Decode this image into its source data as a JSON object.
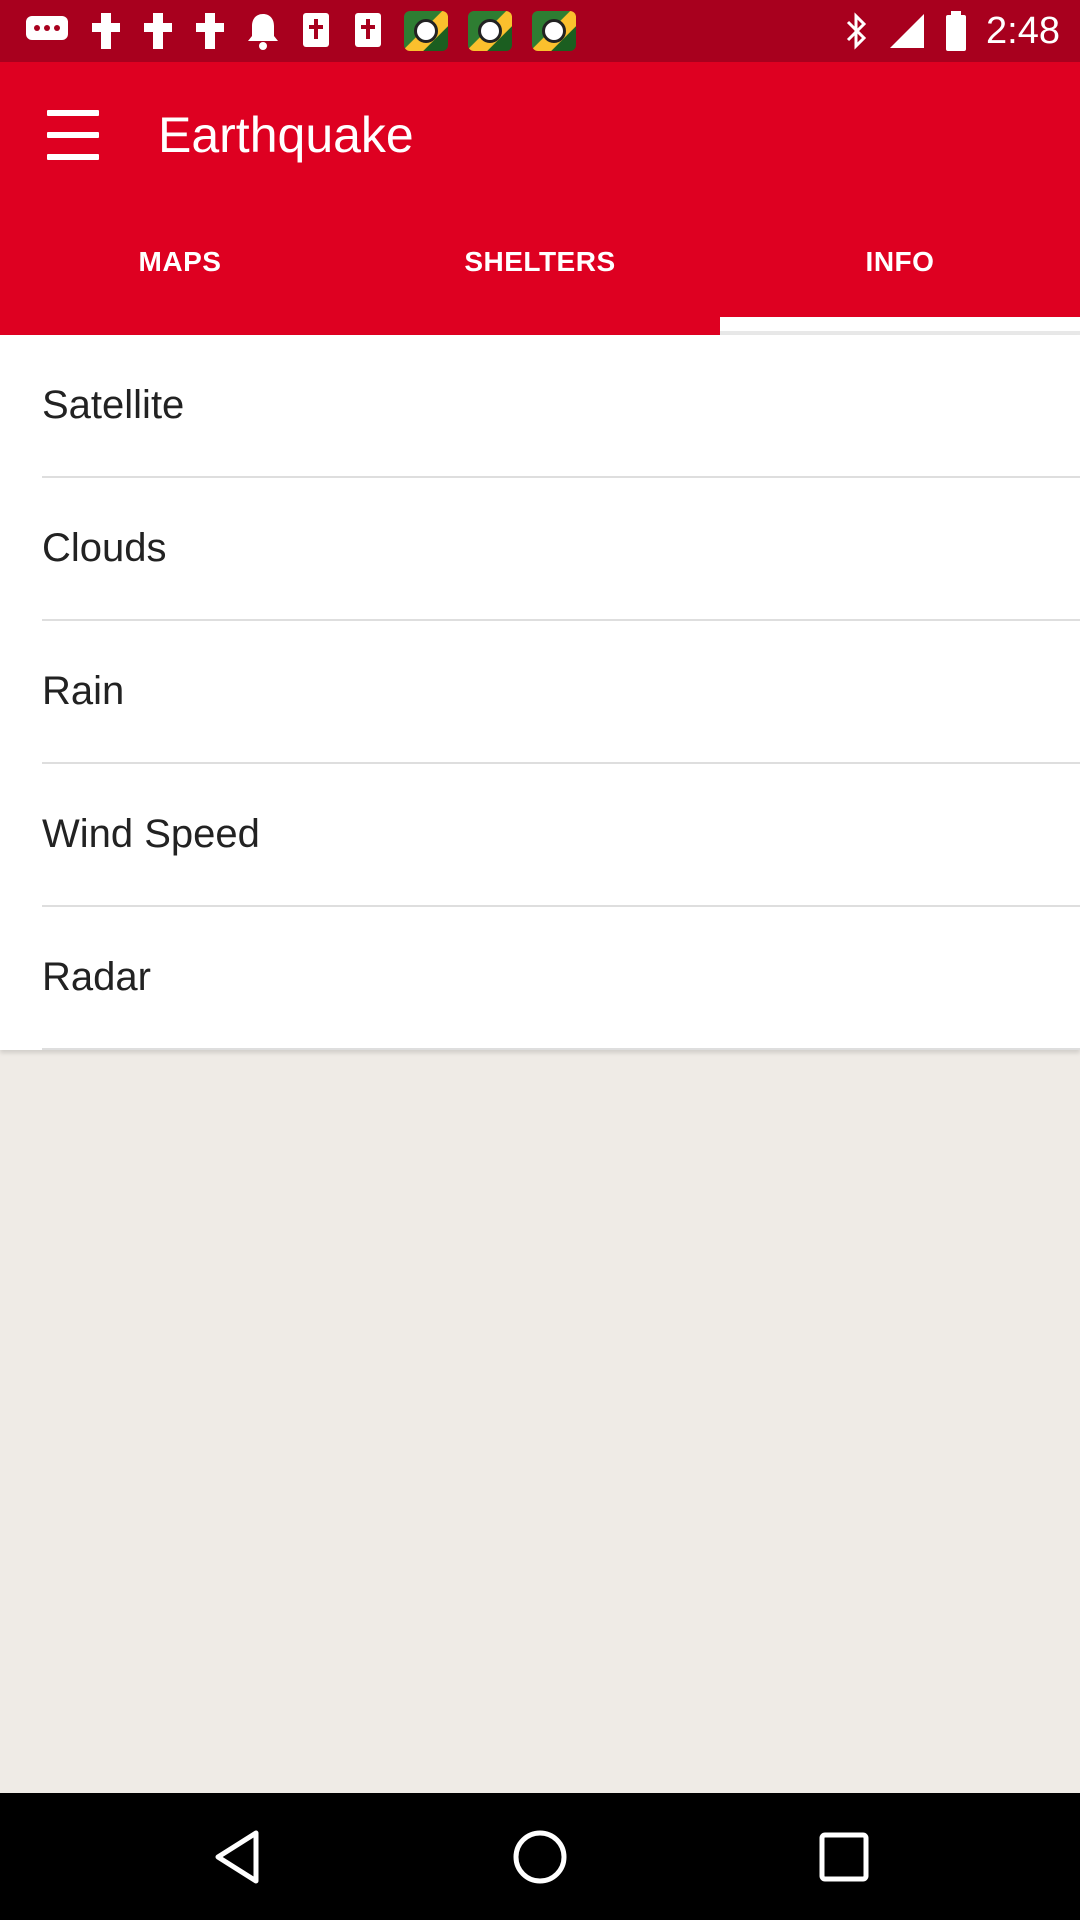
{
  "status_bar": {
    "time": "2:48",
    "notification_icons": [
      "chat-icon",
      "cross-icon",
      "cross-icon",
      "cross-icon",
      "bell-icon",
      "bible-icon",
      "bible-icon",
      "soccer-app-icon",
      "soccer-app-icon",
      "soccer-app-icon"
    ],
    "system_icons": [
      "bluetooth-icon",
      "signal-icon",
      "battery-icon"
    ]
  },
  "toolbar": {
    "title": "Earthquake",
    "menu_icon": "hamburger-menu-icon"
  },
  "tabs": [
    {
      "label": "MAPS",
      "selected": false
    },
    {
      "label": "SHELTERS",
      "selected": false
    },
    {
      "label": "INFO",
      "selected": true
    }
  ],
  "list": {
    "items": [
      {
        "label": "Satellite"
      },
      {
        "label": "Clouds"
      },
      {
        "label": "Rain"
      },
      {
        "label": "Wind Speed"
      },
      {
        "label": "Radar"
      }
    ]
  },
  "nav_bar": {
    "back_icon": "back-triangle-icon",
    "home_icon": "home-circle-icon",
    "recents_icon": "recents-square-icon"
  },
  "colors": {
    "status_bar": "#a8001e",
    "toolbar": "#de0021",
    "background": "#efebe6",
    "nav_bar": "#000000"
  }
}
